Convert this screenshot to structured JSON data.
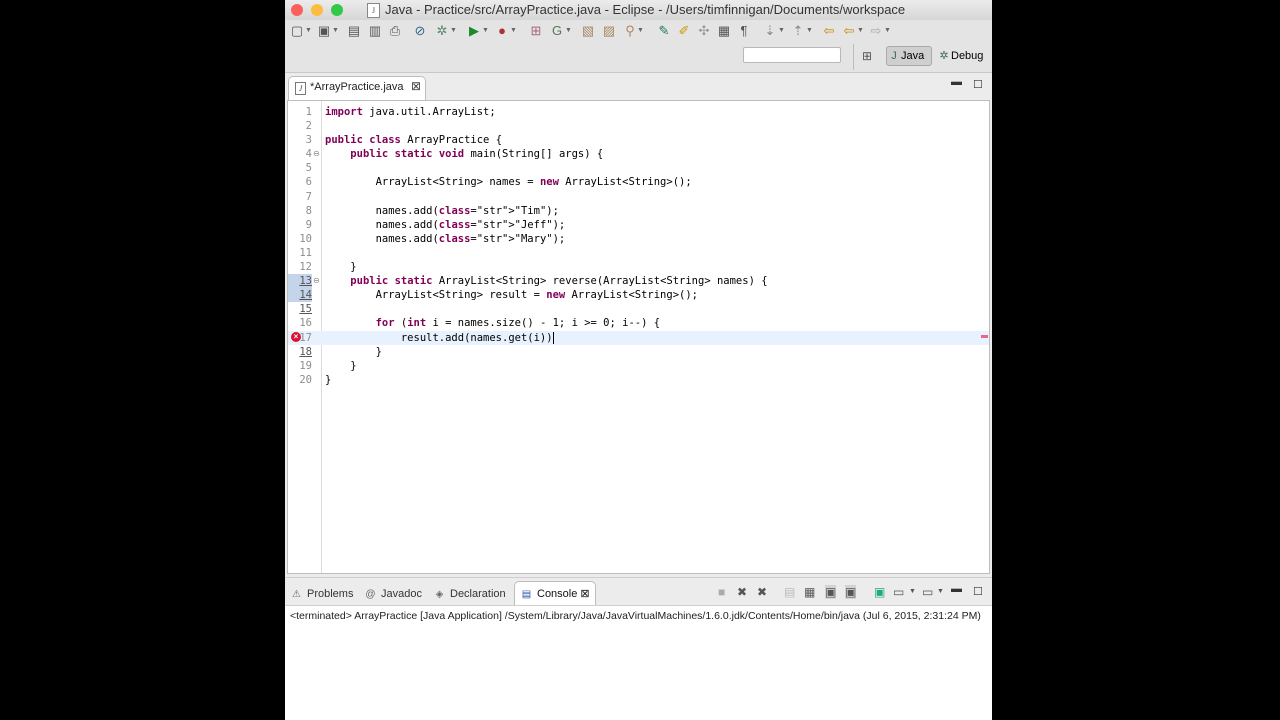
{
  "window": {
    "title": "Java - Practice/src/ArrayPractice.java - Eclipse - /Users/timfinnigan/Documents/workspace",
    "traffic_colors": [
      "#fc605c",
      "#fdbc40",
      "#34c84a"
    ]
  },
  "toolbar": {
    "icons": [
      "new-icon",
      "save-icon",
      "save-all-icon",
      "print-icon",
      "skip-breakpoints-icon",
      "debug-icon",
      "run-icon",
      "run-external-icon",
      "new-java-project-icon",
      "new-package-icon",
      "new-class-icon",
      "open-type-icon",
      "search-icon",
      "next-annotation-icon",
      "prev-annotation-icon",
      "back-icon",
      "forward-icon"
    ]
  },
  "perspectives": {
    "quick_access_value": "",
    "java_label": "Java",
    "debug_label": "Debug"
  },
  "editor": {
    "tab_label": "*ArrayPractice.java",
    "tab_close": "⊠",
    "lines": [
      {
        "n": "1",
        "code": "import java.util.ArrayList;"
      },
      {
        "n": "2",
        "code": ""
      },
      {
        "n": "3",
        "code": "public class ArrayPractice {"
      },
      {
        "n": "4",
        "code": "    public static void main(String[] args) {"
      },
      {
        "n": "5",
        "code": ""
      },
      {
        "n": "6",
        "code": "        ArrayList<String> names = new ArrayList<String>();"
      },
      {
        "n": "7",
        "code": ""
      },
      {
        "n": "8",
        "code": "        names.add(\"Tim\");"
      },
      {
        "n": "9",
        "code": "        names.add(\"Jeff\");"
      },
      {
        "n": "10",
        "code": "        names.add(\"Mary\");"
      },
      {
        "n": "11",
        "code": ""
      },
      {
        "n": "12",
        "code": "    }"
      },
      {
        "n": "13",
        "code": "    public static ArrayList<String> reverse(ArrayList<String> names) {"
      },
      {
        "n": "14",
        "code": "        ArrayList<String> result = new ArrayList<String>();"
      },
      {
        "n": "15",
        "code": ""
      },
      {
        "n": "16",
        "code": "        for (int i = names.size() - 1; i >= 0; i--) {"
      },
      {
        "n": "17",
        "code": "            result.add(names.get(i))"
      },
      {
        "n": "18",
        "code": "        }"
      },
      {
        "n": "19",
        "code": "    }"
      },
      {
        "n": "20",
        "code": "}"
      }
    ]
  },
  "bottom_panel": {
    "tabs": {
      "problems": "Problems",
      "javadoc": "Javadoc",
      "declaration": "Declaration",
      "console": "Console"
    },
    "console_close": "⊠",
    "console_status": "<terminated> ArrayPractice [Java Application] /System/Library/Java/JavaVirtualMachines/1.6.0.jdk/Contents/Home/bin/java (Jul 6, 2015, 2:31:24 PM)"
  }
}
